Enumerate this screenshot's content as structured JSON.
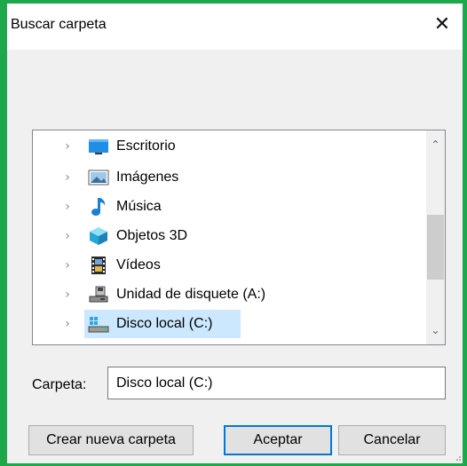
{
  "window": {
    "title": "Buscar carpeta",
    "close_symbol": "✕"
  },
  "tree": {
    "items": [
      {
        "label": "Escritorio",
        "icon": "desktop-icon",
        "selected": false
      },
      {
        "label": "Imágenes",
        "icon": "pictures-icon",
        "selected": false
      },
      {
        "label": "Música",
        "icon": "music-icon",
        "selected": false
      },
      {
        "label": "Objetos 3D",
        "icon": "3d-objects-icon",
        "selected": false
      },
      {
        "label": "Vídeos",
        "icon": "videos-icon",
        "selected": false
      },
      {
        "label": "Unidad de disquete (A:)",
        "icon": "floppy-drive-icon",
        "selected": false
      },
      {
        "label": "Disco local (C:)",
        "icon": "local-disk-icon",
        "selected": true
      }
    ],
    "chevron": "›",
    "scroll_up": "⌃",
    "scroll_down": "⌄"
  },
  "folder": {
    "label": "Carpeta:",
    "value": "Disco local (C:)"
  },
  "buttons": {
    "new_folder": "Crear nueva carpeta",
    "ok": "Aceptar",
    "cancel": "Cancelar"
  },
  "colors": {
    "frame": "#1ea84b",
    "selection": "#cce8ff",
    "default_button_border": "#0078d7"
  }
}
